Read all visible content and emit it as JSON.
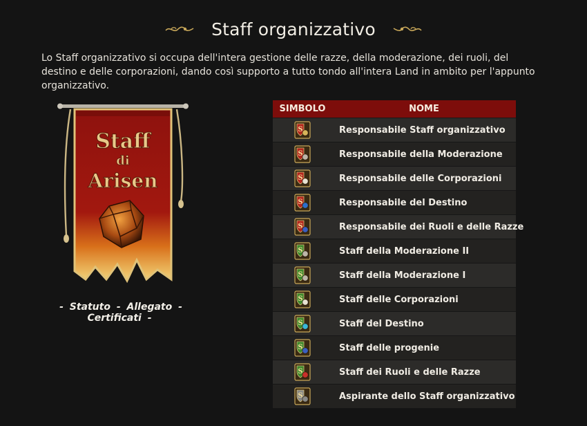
{
  "page": {
    "title": "Staff organizzativo",
    "intro": "Lo Staff organizzativo si occupa dell'intera gestione delle razze, della moderazione, dei ruoli, del destino e delle corporazioni, dando così supporto a tutto tondo all'intera Land in ambito per l'appunto organizzativo."
  },
  "banner": {
    "line1": "Staff",
    "line2": "di",
    "line3": "Arisen"
  },
  "links": {
    "statuto": "Statuto",
    "allegato": "Allegato",
    "certificati": "Certificati",
    "separator": "-"
  },
  "table": {
    "headers": {
      "symbol": "SIMBOLO",
      "name": "NOME"
    },
    "rows": [
      {
        "name": "Responsabile Staff organizzativo",
        "emblem": "red-shield-scroll-icon",
        "shield": "#b3261e",
        "mark": "#d7b45a"
      },
      {
        "name": "Responsabile della Moderazione",
        "emblem": "red-shield-helmet-icon",
        "shield": "#b3261e",
        "mark": "#bdb6a8"
      },
      {
        "name": "Responsabile delle Corporazioni",
        "emblem": "red-shield-document-icon",
        "shield": "#b3261e",
        "mark": "#e8e2d2"
      },
      {
        "name": "Responsabile del Destino",
        "emblem": "red-shield-star-icon",
        "shield": "#b3261e",
        "mark": "#2d6fc9"
      },
      {
        "name": "Responsabile dei Ruoli e delle Razze",
        "emblem": "red-shield-dice-icon",
        "shield": "#b3261e",
        "mark": "#3b5fc0"
      },
      {
        "name": "Staff della Moderazione II",
        "emblem": "green-shield-helmet-icon",
        "shield": "#3f8a2e",
        "mark": "#bdb6a8"
      },
      {
        "name": "Staff della Moderazione I",
        "emblem": "green-shield-helmet-icon",
        "shield": "#3f8a2e",
        "mark": "#bdb6a8"
      },
      {
        "name": "Staff delle Corporazioni",
        "emblem": "green-shield-document-icon",
        "shield": "#3f8a2e",
        "mark": "#e8e2d2"
      },
      {
        "name": "Staff del Destino",
        "emblem": "green-shield-star-icon",
        "shield": "#3f8a2e",
        "mark": "#3ab7d8"
      },
      {
        "name": "Staff delle progenie",
        "emblem": "green-shield-dice-icon",
        "shield": "#3f8a2e",
        "mark": "#3b5fc0"
      },
      {
        "name": "Staff dei Ruoli e delle Razze",
        "emblem": "green-shield-red-dice-icon",
        "shield": "#3f8a2e",
        "mark": "#c9302a"
      },
      {
        "name": "Aspirante dello Staff organizzativo",
        "emblem": "grey-shield-icon",
        "shield": "#8a8a86",
        "mark": "#8a8a86"
      }
    ]
  },
  "colors": {
    "background": "#141414",
    "header_red": "#7d0d0b",
    "banner_red": "#9c1410",
    "gold": "#c9a85a"
  }
}
